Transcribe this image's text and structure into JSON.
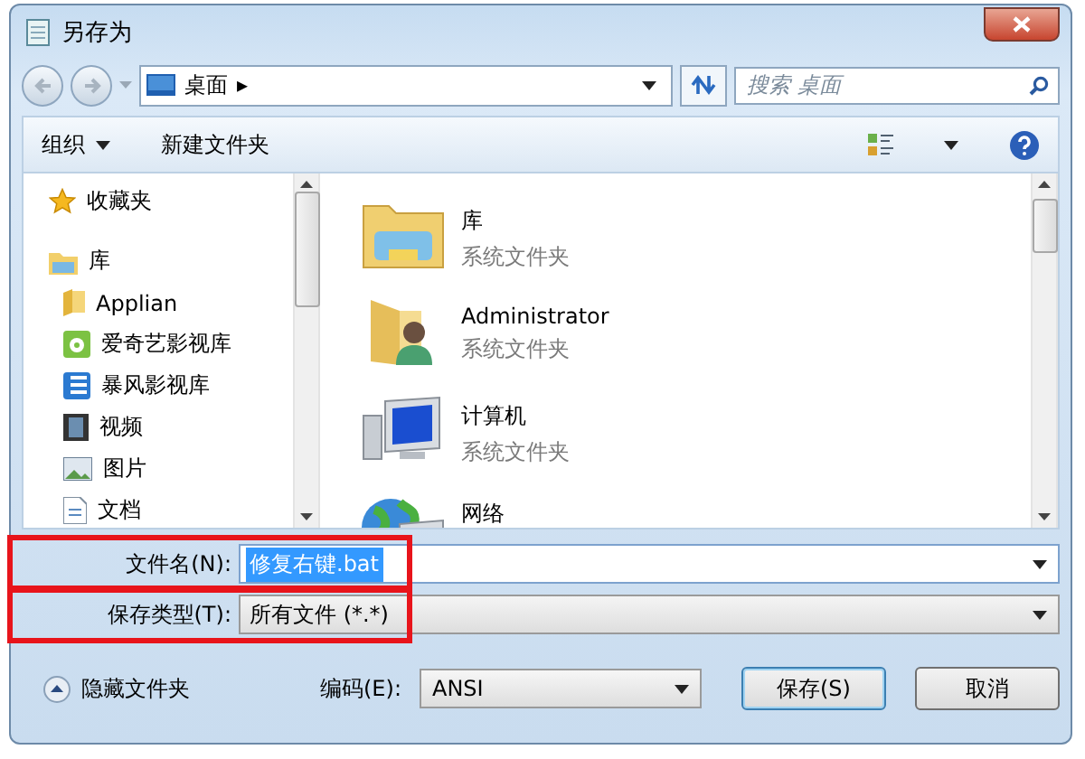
{
  "window": {
    "title": "另存为"
  },
  "address": {
    "location": "桌面",
    "arrow": "▸"
  },
  "search": {
    "placeholder": "搜索 桌面"
  },
  "toolbar": {
    "organize": "组织",
    "new_folder": "新建文件夹"
  },
  "sidebar": {
    "items": [
      {
        "label": "收藏夹"
      },
      {
        "label": "库",
        "children": [
          {
            "label": "Applian"
          },
          {
            "label": "爱奇艺影视库"
          },
          {
            "label": "暴风影视库"
          },
          {
            "label": "视频"
          },
          {
            "label": "图片"
          },
          {
            "label": "文档"
          }
        ]
      }
    ]
  },
  "files": [
    {
      "name": "库",
      "type": "系统文件夹"
    },
    {
      "name": "Administrator",
      "type": "系统文件夹"
    },
    {
      "name": "计算机",
      "type": "系统文件夹"
    },
    {
      "name": "网络"
    }
  ],
  "form": {
    "filename": {
      "label": "文件名(N):",
      "value": "修复右键.bat",
      "selected": true,
      "highlighted": true
    },
    "filetype": {
      "label": "保存类型(T):",
      "value": "所有文件 (*.*)",
      "highlighted": true
    }
  },
  "footer": {
    "hide_folders": "隐藏文件夹",
    "encoding_label": "编码(E):",
    "encoding": "ANSI",
    "save": "保存(S)",
    "cancel": "取消"
  }
}
